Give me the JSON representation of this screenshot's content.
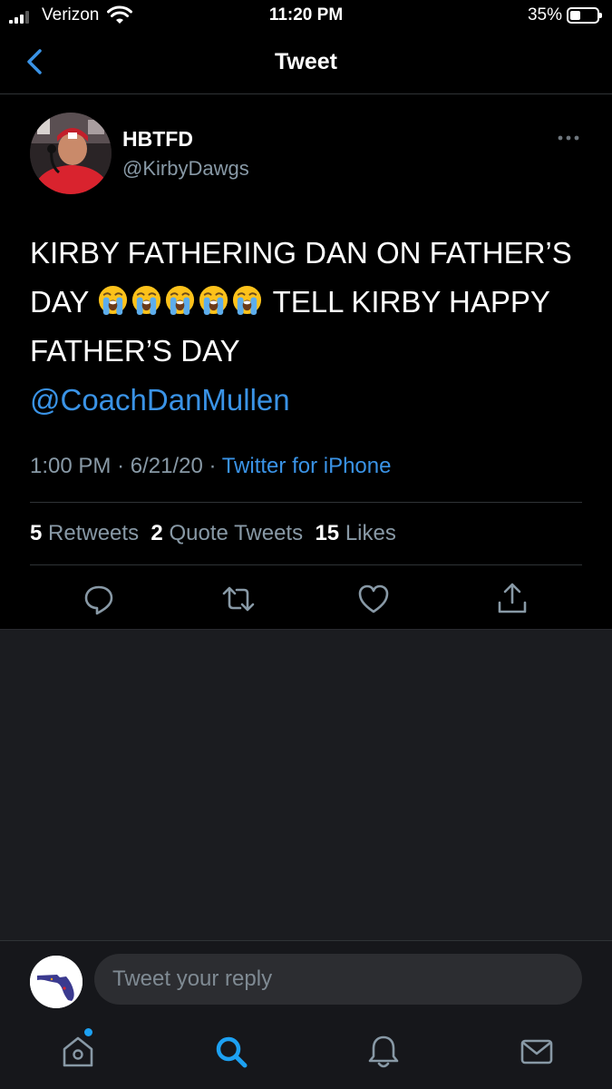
{
  "status_bar": {
    "carrier": "Verizon",
    "time": "11:20 PM",
    "battery_percent": "35%",
    "battery_level": 0.35
  },
  "nav": {
    "title": "Tweet",
    "back_icon": "chevron-left-icon"
  },
  "tweet": {
    "display_name": "HBTFD",
    "handle": "@KirbyDawgs",
    "text_part1": "KIRBY FATHERING DAN ON FATHER’S DAY",
    "emoji": [
      "loudly-crying-face",
      "loudly-crying-face",
      "loudly-crying-face",
      "loudly-crying-face",
      "loudly-crying-face"
    ],
    "text_part2": "TELL KIRBY HAPPY FATHER’S DAY",
    "mention": "@CoachDanMullen",
    "time": "1:00 PM",
    "date": "6/21/20",
    "separator": "·",
    "source": "Twitter for iPhone"
  },
  "stats": {
    "retweets_count": "5",
    "retweets_label": "Retweets",
    "quotes_count": "2",
    "quotes_label": "Quote Tweets",
    "likes_count": "15",
    "likes_label": "Likes"
  },
  "actions": [
    "reply-icon",
    "retweet-icon",
    "like-icon",
    "share-icon"
  ],
  "reply": {
    "placeholder": "Tweet your reply"
  },
  "tabbar": {
    "items": [
      "home-icon",
      "search-icon",
      "notifications-icon",
      "messages-icon"
    ],
    "active": "search-icon"
  },
  "colors": {
    "background": "#000000",
    "accent": "#3a93e6",
    "secondary_text": "#8899a6",
    "divider": "#2f3336"
  }
}
